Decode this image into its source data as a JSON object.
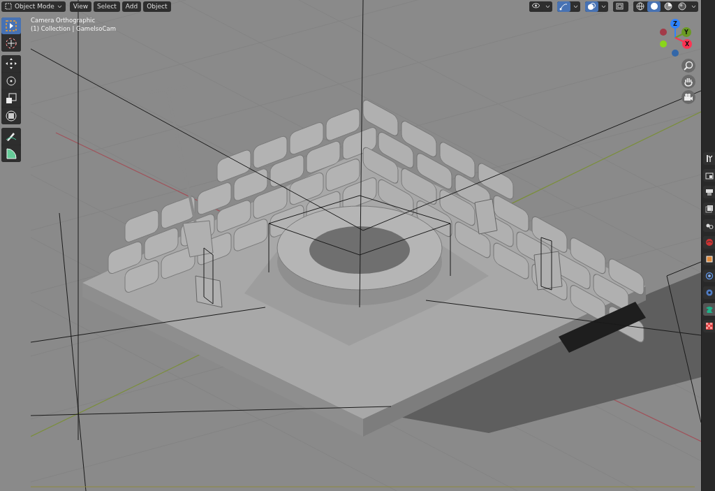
{
  "header": {
    "mode_menu": {
      "label": "Object Mode"
    },
    "menus": [
      "View",
      "Select",
      "Add",
      "Object"
    ],
    "toggles": [
      {
        "kind": "visibility",
        "selected": false
      },
      {
        "kind": "gizmo",
        "selected": true
      },
      {
        "kind": "overlay",
        "selected": true
      },
      {
        "kind": "xray",
        "selected": false
      }
    ],
    "shading": [
      {
        "kind": "wireframe",
        "selected": false
      },
      {
        "kind": "solid",
        "selected": true
      },
      {
        "kind": "material",
        "selected": false
      },
      {
        "kind": "rendered",
        "selected": false
      }
    ]
  },
  "viewport_info": [
    "Camera Orthographic",
    "(1) Collection | GameIsoCam"
  ],
  "toolbar": [
    [
      {
        "kind": "select",
        "selected": true
      },
      {
        "kind": "cursor",
        "selected": false
      }
    ],
    [
      {
        "kind": "move",
        "selected": false
      },
      {
        "kind": "rotate",
        "selected": false
      },
      {
        "kind": "scale",
        "selected": false
      },
      {
        "kind": "transform",
        "selected": false
      }
    ],
    [
      {
        "kind": "annotate",
        "selected": false
      },
      {
        "kind": "measure",
        "selected": false
      }
    ]
  ],
  "gizmo_axes": [
    {
      "label": "Z",
      "color": "#2f83ff"
    },
    {
      "label": "Y",
      "color": "#6a9a23"
    },
    {
      "label": "X",
      "color": "#ff3352"
    }
  ],
  "properties_tabs": [
    {
      "kind": "tool",
      "selected": false
    },
    {
      "kind": "render",
      "selected": false
    },
    {
      "kind": "output",
      "selected": false
    },
    {
      "kind": "view-layer",
      "selected": false
    },
    {
      "kind": "scene",
      "selected": false
    },
    {
      "kind": "world",
      "selected": false
    },
    {
      "kind": "object",
      "selected": false
    },
    {
      "kind": "modifiers",
      "selected": false
    },
    {
      "kind": "particles",
      "selected": false
    },
    {
      "kind": "physics",
      "selected": true
    },
    {
      "kind": "texture",
      "selected": false
    }
  ]
}
